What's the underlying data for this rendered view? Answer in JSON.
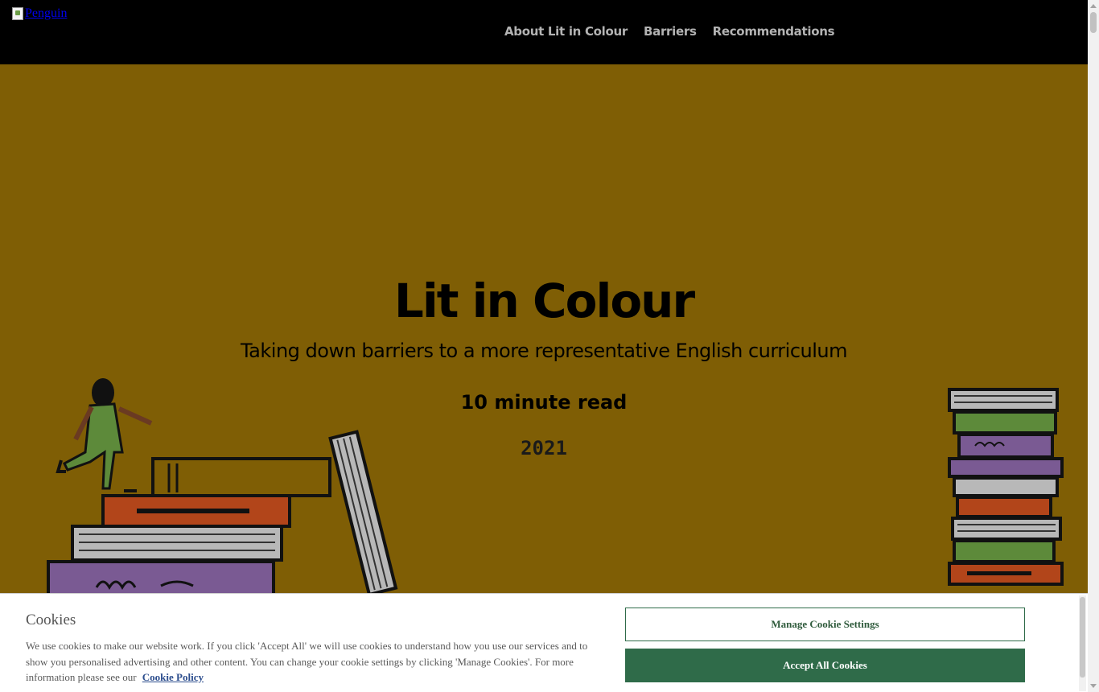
{
  "header": {
    "logo_alt": "Penguin",
    "nav": [
      {
        "label": "About Lit in Colour"
      },
      {
        "label": "Barriers"
      },
      {
        "label": "Recommendations"
      }
    ]
  },
  "hero": {
    "title": "Lit in Colour",
    "subtitle": "Taking down barriers to a more representative English curriculum",
    "read_time": "10 minute read",
    "year": "2021",
    "background_color": "#7f5e05"
  },
  "cookie_banner": {
    "title": "Cookies",
    "text": "We use cookies to make our website work. If you click 'Accept All' we will use cookies to understand how you use our services and to show you personalised advertising and other content. You can change your cookie settings by clicking 'Manage Cookies'. For more information please see our",
    "policy_link": "Cookie Policy",
    "manage_button": "Manage Cookie Settings",
    "accept_button": "Accept All Cookies",
    "accent_color": "#2f6b49"
  }
}
